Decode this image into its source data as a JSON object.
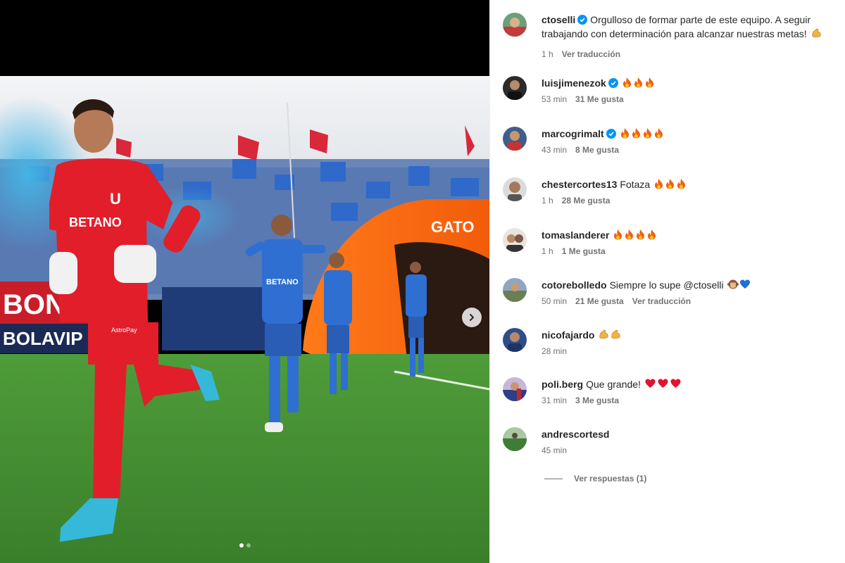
{
  "post": {
    "carousel": {
      "dots": 2,
      "active_index": 0
    },
    "caption": {
      "username": "ctoselli",
      "verified": true,
      "text": "Orgulloso de formar parte de este equipo. A seguir trabajando con determinación para alcanzar nuestras metas!",
      "emoji": "flexed-biceps",
      "time": "1 h",
      "translate": "Ver traducción"
    },
    "photo_signage": {
      "sponsor": "BETANO",
      "gatorade": "GATO",
      "banner": "BOLAVIP",
      "board_left": "BONA",
      "shorts": "AstroPay"
    }
  },
  "comments": [
    {
      "username": "luisjimenezok",
      "verified": true,
      "text": "",
      "emojis": [
        "fire",
        "fire",
        "fire"
      ],
      "time": "53 min",
      "likes": "31 Me gusta"
    },
    {
      "username": "marcogrimalt",
      "verified": true,
      "text": "",
      "emojis": [
        "fire",
        "fire",
        "fire",
        "fire"
      ],
      "time": "43 min",
      "likes": "8 Me gusta"
    },
    {
      "username": "chestercortes13",
      "verified": false,
      "text": "Fotaza",
      "emojis": [
        "fire",
        "fire",
        "fire"
      ],
      "time": "1 h",
      "likes": "28 Me gusta"
    },
    {
      "username": "tomaslanderer",
      "verified": false,
      "text": "",
      "emojis": [
        "fire",
        "fire",
        "fire",
        "fire"
      ],
      "time": "1 h",
      "likes": "1 Me gusta"
    },
    {
      "username": "cotorebolledo",
      "verified": false,
      "text": "Siempre lo supe @ctoselli",
      "emojis": [
        "monkey",
        "blue-heart"
      ],
      "time": "50 min",
      "likes": "21 Me gusta",
      "translate": "Ver traducción"
    },
    {
      "username": "nicofajardo",
      "verified": false,
      "text": "",
      "emojis": [
        "flexed-biceps",
        "flexed-biceps"
      ],
      "time": "28 min"
    },
    {
      "username": "poli.berg",
      "verified": false,
      "text": "Que grande!",
      "emojis": [
        "red-heart",
        "red-heart",
        "red-heart"
      ],
      "time": "31 min",
      "likes": "3 Me gusta"
    },
    {
      "username": "andrescortesd",
      "verified": false,
      "text": "",
      "emojis": [],
      "time": "45 min"
    }
  ],
  "replies_link": "Ver respuestas (1)",
  "colors": {
    "verified": "#0095f6",
    "meta": "#737373",
    "text": "#262626"
  }
}
